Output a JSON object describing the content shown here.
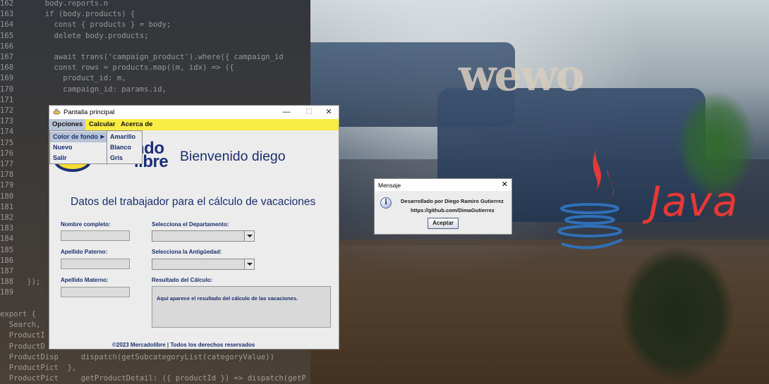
{
  "background": {
    "code_lines": [
      "162       body.reports.n",
      "163       if (body.products) {",
      "164         const { products } = body;",
      "165         delete body.products;",
      "166",
      "167         await trans('campaign_product').where({ campaign_id",
      "168         const rows = products.map((m, idx) => ({",
      "169           product_id: m,",
      "170           campaign_id: params.id,",
      "171",
      "172",
      "173",
      "174",
      "175",
      "176",
      "177",
      "178",
      "179",
      "180",
      "181",
      "182",
      "183",
      "184",
      "185",
      "186",
      "187",
      "188   });",
      "189",
      "",
      "export {",
      "  Search,",
      "  ProductI",
      "  ProductD",
      "  ProductDisp     dispatch(getSubcategoryList(categoryValue))",
      "  ProductPict  },",
      "  ProductPict     getProductDetail: ({ productId }) => dispatch(getP"
    ],
    "sign_text": "wewo",
    "java_text": "Java",
    "colors": {
      "java_red": "#e53935",
      "java_blue": "#2f6fb8"
    }
  },
  "main_window": {
    "title": "Pantalla principal",
    "menu": [
      "Opciones",
      "Calcular",
      "Acerca de"
    ],
    "opciones_items": [
      "Color de fondo",
      "Nuevo",
      "Salir"
    ],
    "color_items": [
      "Amarillo",
      "Blanco",
      "Gris"
    ],
    "logo_lines": [
      "ndo",
      "libre"
    ],
    "welcome": "Bienvenido diego",
    "section_title": "Datos del trabajador para el cálculo de vacaciones",
    "labels": {
      "nombre": "Nombre completo:",
      "paterno": "Apellido Paterno:",
      "materno": "Apellido Materno:",
      "departamento": "Selecciona el Departamento:",
      "antiguedad": "Selecciona la Antigüedad:",
      "resultado": "Resultado del Cálculo:"
    },
    "result_text": "Aqui aparece el resultado del cálculo de las vacaciones.",
    "footer": "©2023 Mercadolibre | Todos los derechos reservados",
    "colors": {
      "menubar": "#f7ec42",
      "label_text": "#1a2f6e",
      "menu_highlight": "#b8c4d6"
    }
  },
  "dialog": {
    "title": "Mensaje",
    "line1": "Desarrollado por Diego Ramiro Gutierrez",
    "line2": "https://github.com/DimaGutierrez",
    "button": "Aceptar",
    "icon": "info-icon"
  }
}
